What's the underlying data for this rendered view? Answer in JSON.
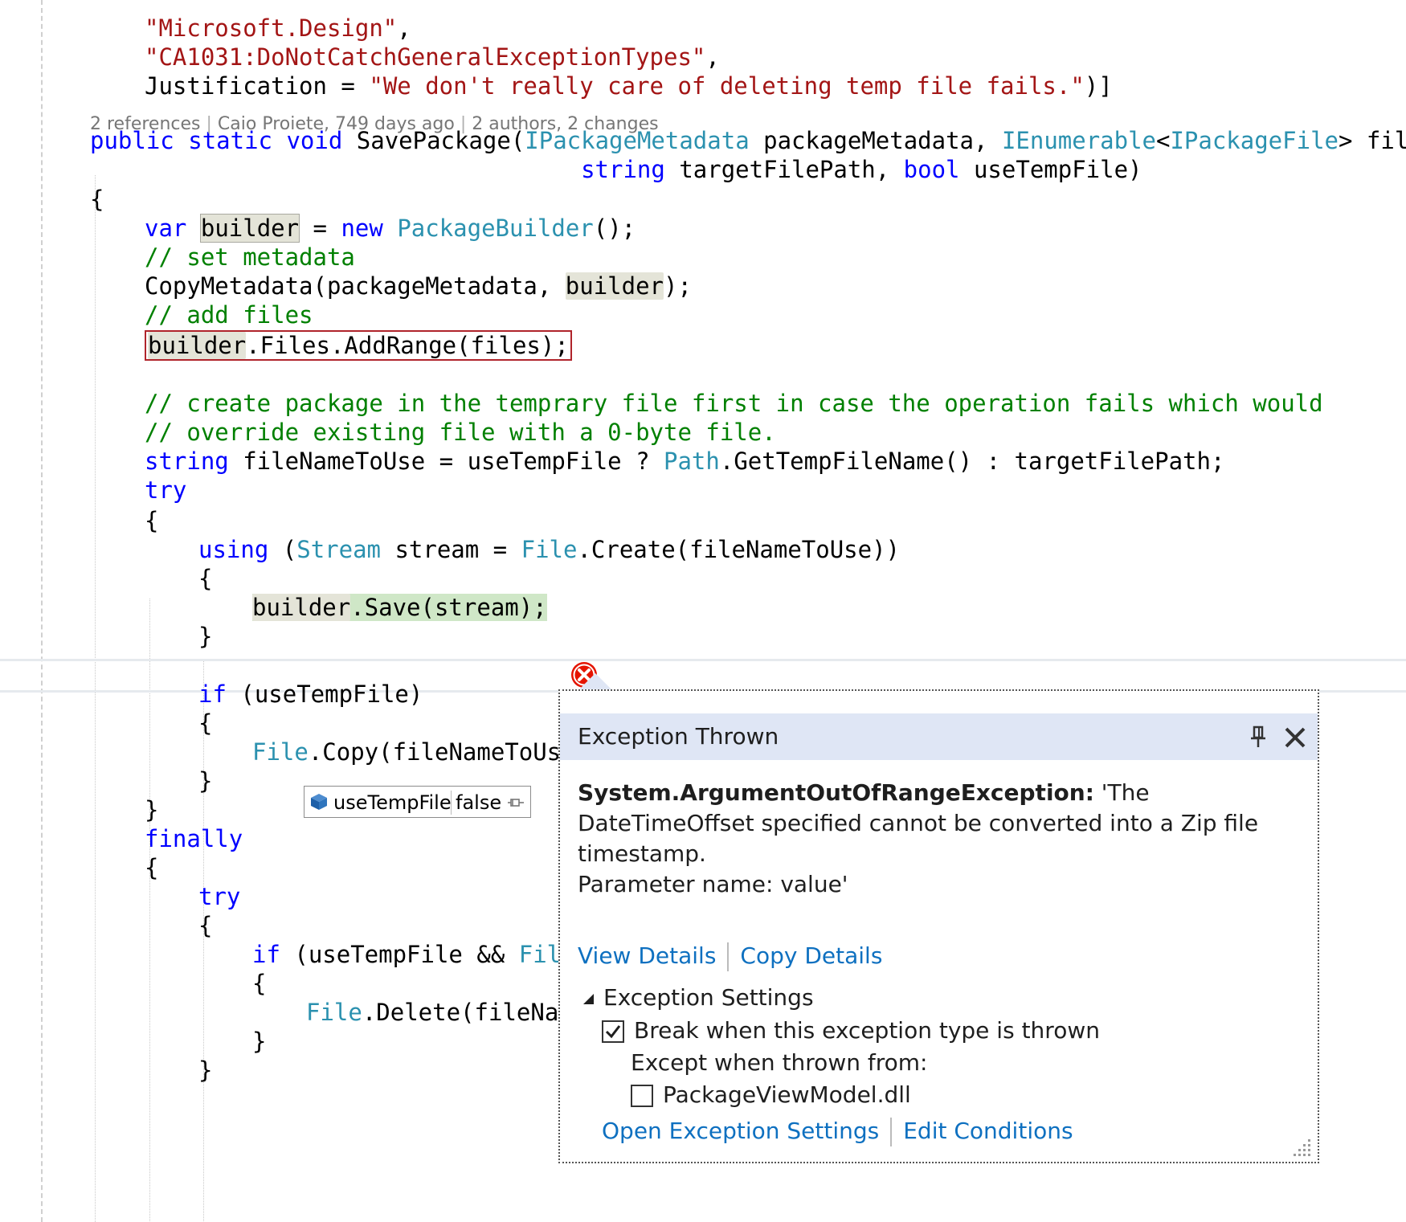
{
  "code": {
    "lines": [
      {
        "indent": 2,
        "parts": [
          {
            "t": "\"Microsoft.Design\"",
            "c": "str"
          },
          {
            "t": ",",
            "c": ""
          }
        ]
      },
      {
        "indent": 2,
        "parts": [
          {
            "t": "\"CA1031:DoNotCatchGeneralExceptionTypes\"",
            "c": "str"
          },
          {
            "t": ",",
            "c": ""
          }
        ]
      },
      {
        "indent": 2,
        "parts": [
          {
            "t": "Justification = ",
            "c": ""
          },
          {
            "t": "\"We don't really care of deleting temp file fails.\"",
            "c": "str"
          },
          {
            "t": ")]",
            "c": ""
          }
        ]
      },
      {
        "indent": 1,
        "parts": [
          {
            "t": "public",
            "c": "kw"
          },
          {
            "t": " ",
            "c": ""
          },
          {
            "t": "static",
            "c": "kw"
          },
          {
            "t": " ",
            "c": ""
          },
          {
            "t": "void",
            "c": "kw"
          },
          {
            "t": " SavePackage(",
            "c": ""
          },
          {
            "t": "IPackageMetadata",
            "c": "type"
          },
          {
            "t": " packageMetadata, ",
            "c": ""
          },
          {
            "t": "IEnumerable",
            "c": "type"
          },
          {
            "t": "<",
            "c": ""
          },
          {
            "t": "IPackageFile",
            "c": "type"
          },
          {
            "t": "> files,",
            "c": ""
          }
        ]
      },
      {
        "indent": 0,
        "parts": [
          {
            "t": "                                   ",
            "c": ""
          },
          {
            "t": "string",
            "c": "kw"
          },
          {
            "t": " targetFilePath, ",
            "c": ""
          },
          {
            "t": "bool",
            "c": "kw"
          },
          {
            "t": " useTempFile)",
            "c": ""
          }
        ]
      },
      {
        "indent": 1,
        "parts": [
          {
            "t": "{",
            "c": ""
          }
        ]
      },
      {
        "indent": 2,
        "parts": [
          {
            "t": "var",
            "c": "kw"
          },
          {
            "t": " ",
            "c": ""
          },
          {
            "t": "builder",
            "c": "",
            "h": "hl-ref-box"
          },
          {
            "t": " = ",
            "c": ""
          },
          {
            "t": "new",
            "c": "kw"
          },
          {
            "t": " ",
            "c": ""
          },
          {
            "t": "PackageBuilder",
            "c": "type"
          },
          {
            "t": "();",
            "c": ""
          }
        ]
      },
      {
        "indent": 2,
        "parts": [
          {
            "t": "// set metadata",
            "c": "cmt"
          }
        ]
      },
      {
        "indent": 2,
        "parts": [
          {
            "t": "CopyMetadata(packageMetadata, ",
            "c": ""
          },
          {
            "t": "builder",
            "c": "",
            "h": "hl-ref"
          },
          {
            "t": ");",
            "c": ""
          }
        ]
      },
      {
        "indent": 2,
        "parts": [
          {
            "t": "// add files",
            "c": "cmt"
          }
        ]
      },
      {
        "indent": 2,
        "err": true,
        "parts": [
          {
            "t": "builder",
            "c": "",
            "h": "hl-ref"
          },
          {
            "t": ".Files.AddRange(files);",
            "c": ""
          }
        ]
      },
      {
        "indent": 2,
        "parts": []
      },
      {
        "indent": 2,
        "parts": [
          {
            "t": "// create package in the temprary file first in case the operation fails which would",
            "c": "cmt"
          }
        ]
      },
      {
        "indent": 2,
        "parts": [
          {
            "t": "// override existing file with a 0-byte file.",
            "c": "cmt"
          }
        ]
      },
      {
        "indent": 2,
        "parts": [
          {
            "t": "string",
            "c": "kw"
          },
          {
            "t": " fileNameToUse = useTempFile ? ",
            "c": ""
          },
          {
            "t": "Path",
            "c": "type"
          },
          {
            "t": ".GetTempFileName() : targetFilePath;",
            "c": ""
          }
        ]
      },
      {
        "indent": 2,
        "parts": [
          {
            "t": "try",
            "c": "kw"
          }
        ]
      },
      {
        "indent": 2,
        "parts": [
          {
            "t": "{",
            "c": ""
          }
        ]
      },
      {
        "indent": 3,
        "parts": [
          {
            "t": "using",
            "c": "kw"
          },
          {
            "t": " (",
            "c": ""
          },
          {
            "t": "Stream",
            "c": "type"
          },
          {
            "t": " stream = ",
            "c": ""
          },
          {
            "t": "File",
            "c": "type"
          },
          {
            "t": ".Create(fileNameToUse))",
            "c": ""
          }
        ]
      },
      {
        "indent": 3,
        "parts": [
          {
            "t": "{",
            "c": ""
          }
        ]
      },
      {
        "indent": 4,
        "current": true,
        "parts": [
          {
            "t": "builder",
            "c": "",
            "h": "hl-ref"
          },
          {
            "t": ".Save(stream);",
            "c": ""
          }
        ]
      },
      {
        "indent": 3,
        "parts": [
          {
            "t": "}",
            "c": ""
          }
        ]
      },
      {
        "indent": 3,
        "parts": []
      },
      {
        "indent": 3,
        "parts": [
          {
            "t": "if",
            "c": "kw"
          },
          {
            "t": " (useTempFile)",
            "c": ""
          }
        ]
      },
      {
        "indent": 3,
        "parts": [
          {
            "t": "{",
            "c": ""
          }
        ]
      },
      {
        "indent": 4,
        "parts": [
          {
            "t": "File",
            "c": "type"
          },
          {
            "t": ".Copy(fileNameToUse",
            "c": ""
          }
        ]
      },
      {
        "indent": 3,
        "parts": [
          {
            "t": "}",
            "c": ""
          }
        ]
      },
      {
        "indent": 2,
        "parts": [
          {
            "t": "}",
            "c": ""
          }
        ]
      },
      {
        "indent": 2,
        "parts": [
          {
            "t": "finally",
            "c": "kw"
          }
        ]
      },
      {
        "indent": 2,
        "parts": [
          {
            "t": "{",
            "c": ""
          }
        ]
      },
      {
        "indent": 3,
        "parts": [
          {
            "t": "try",
            "c": "kw"
          }
        ]
      },
      {
        "indent": 3,
        "parts": [
          {
            "t": "{",
            "c": ""
          }
        ]
      },
      {
        "indent": 4,
        "parts": [
          {
            "t": "if",
            "c": "kw"
          },
          {
            "t": " (useTempFile && ",
            "c": ""
          },
          {
            "t": "File",
            "c": "type"
          }
        ]
      },
      {
        "indent": 4,
        "parts": [
          {
            "t": "{",
            "c": ""
          }
        ]
      },
      {
        "indent": 5,
        "parts": [
          {
            "t": "File",
            "c": "type"
          },
          {
            "t": ".Delete(fileNam",
            "c": ""
          }
        ]
      },
      {
        "indent": 4,
        "parts": [
          {
            "t": "}",
            "c": ""
          }
        ]
      },
      {
        "indent": 3,
        "parts": [
          {
            "t": "}",
            "c": ""
          }
        ]
      }
    ]
  },
  "codelens": {
    "references": "2 references",
    "author": "Caio Proiete, 749 days ago",
    "changes": "2 authors, 2 changes"
  },
  "datatip": {
    "name": "useTempFile",
    "value": "false"
  },
  "exception": {
    "title": "Exception Thrown",
    "type": "System.ArgumentOutOfRangeException:",
    "message": " 'The DateTimeOffset specified cannot be converted into a Zip file timestamp.",
    "param": "Parameter name: value'",
    "view_details": "View Details",
    "copy_details": "Copy Details",
    "settings_header": "Exception Settings",
    "break_label": "Break when this exception type is thrown",
    "break_checked": true,
    "except_label": "Except when thrown from:",
    "module_label": "PackageViewModel.dll",
    "module_checked": false,
    "open_settings": "Open Exception Settings",
    "edit_conditions": "Edit Conditions"
  },
  "colors": {
    "keyword": "#0000ff",
    "type": "#2b91af",
    "string": "#a31515",
    "comment": "#008000",
    "link": "#0e70c0",
    "error": "#e51400",
    "popup_header": "#dfe6f5"
  }
}
